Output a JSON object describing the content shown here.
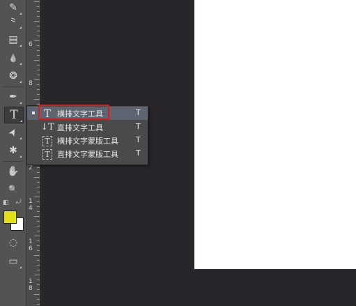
{
  "toolbar": {
    "tools": [
      {
        "name": "brush-icon",
        "glyph": "✎"
      },
      {
        "name": "history-brush-icon",
        "glyph": "⺀"
      },
      {
        "name": "gradient-icon",
        "glyph": "▤"
      },
      {
        "name": "blur-icon",
        "glyph": "💧"
      },
      {
        "name": "sponge-icon",
        "glyph": "❂"
      },
      {
        "name": "pen-icon",
        "glyph": "✒"
      },
      {
        "name": "type-icon",
        "glyph": "T"
      },
      {
        "name": "path-selection-icon",
        "glyph": "➤"
      },
      {
        "name": "custom-shape-icon",
        "glyph": "✱"
      },
      {
        "name": "hand-icon",
        "glyph": "✋"
      },
      {
        "name": "zoom-icon",
        "glyph": "🔍"
      },
      {
        "name": "quick-mask-icon",
        "glyph": "◌"
      },
      {
        "name": "screen-mode-icon",
        "glyph": "▭"
      }
    ],
    "colors": {
      "foreground": "#e3e01a",
      "background": "#ffffff"
    }
  },
  "ruler": {
    "labels": [
      "6",
      "8",
      "1",
      "0",
      "1",
      "2",
      "1",
      "4",
      "1",
      "6",
      "1",
      "8"
    ]
  },
  "flyout": {
    "items": [
      {
        "label": "横排文字工具",
        "shortcut": "T",
        "icon": "T",
        "selected": true
      },
      {
        "label": "直排文字工具",
        "shortcut": "T",
        "icon": "↓T",
        "selected": false
      },
      {
        "label": "横排文字蒙版工具",
        "shortcut": "T",
        "icon": "T",
        "selected": false
      },
      {
        "label": "直排文字蒙版工具",
        "shortcut": "T",
        "icon": "↓T",
        "selected": false
      }
    ]
  }
}
